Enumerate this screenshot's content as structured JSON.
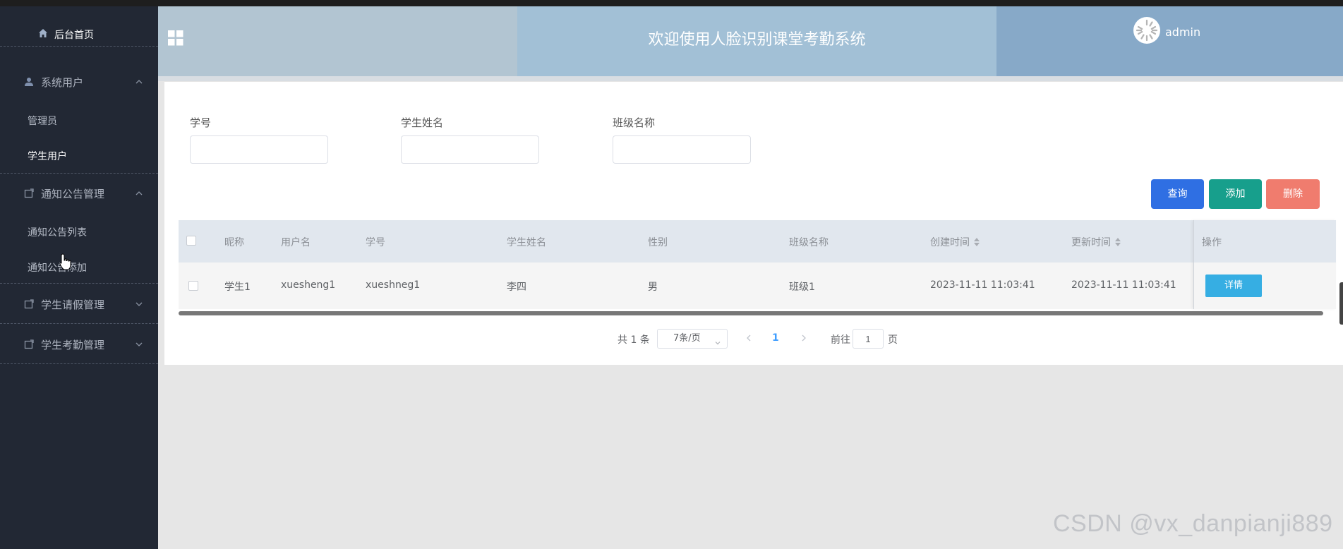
{
  "sidebar": {
    "home_label": "后台首页",
    "groups": [
      {
        "label": "系统用户",
        "items": [
          "管理员",
          "学生用户"
        ],
        "expanded": true,
        "active_item": "学生用户",
        "icon": "user-icon"
      },
      {
        "label": "通知公告管理",
        "items": [
          "通知公告列表",
          "通知公告添加"
        ],
        "expanded": true,
        "icon": "notice-icon"
      },
      {
        "label": "学生请假管理",
        "items": [],
        "expanded": false,
        "icon": "leave-icon"
      },
      {
        "label": "学生考勤管理",
        "items": [],
        "expanded": false,
        "icon": "attendance-icon"
      }
    ]
  },
  "header": {
    "title": "欢迎使用人脸识别课堂考勤系统",
    "username": "admin"
  },
  "filters": {
    "student_no_label": "学号",
    "student_name_label": "学生姓名",
    "class_name_label": "班级名称",
    "student_no_value": "",
    "student_name_value": "",
    "class_name_value": ""
  },
  "actions": {
    "query": "查询",
    "add": "添加",
    "delete": "删除"
  },
  "table": {
    "columns": [
      "昵称",
      "用户名",
      "学号",
      "学生姓名",
      "性别",
      "班级名称",
      "创建时间",
      "更新时间",
      "操作"
    ],
    "rows": [
      {
        "nickname": "学生1",
        "username": "xuesheng1",
        "student_no": "xueshneg1",
        "student_name": "李四",
        "gender": "男",
        "class_name": "班级1",
        "created": "2023-11-11 11:03:41",
        "updated": "2023-11-11 11:03:41",
        "action": "详情"
      }
    ]
  },
  "pagination": {
    "total": "共 1 条",
    "page_size": "7条/页",
    "current_page": "1",
    "goto_prefix": "前往",
    "goto_value": "1",
    "goto_suffix": "页"
  },
  "watermark": "CSDN @vx_danpianji889",
  "colors": {
    "sidebar_bg": "#222834",
    "query_btn": "#2f6fe3",
    "add_btn": "#179f8c",
    "delete_btn": "#f07c6e",
    "detail_btn": "#36aee3"
  }
}
